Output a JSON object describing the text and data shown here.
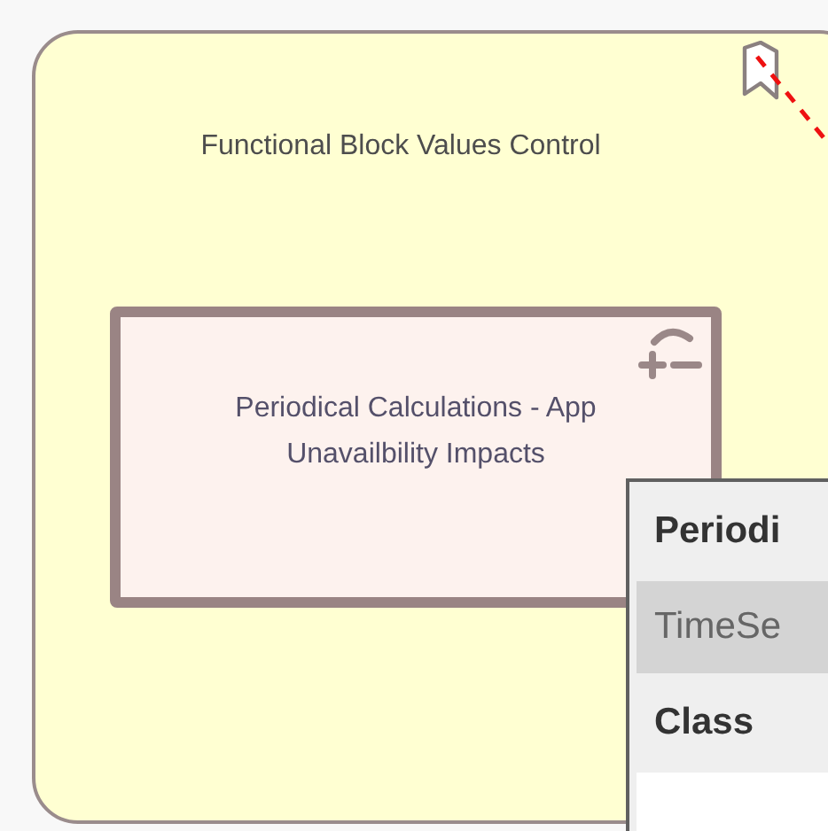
{
  "block": {
    "title": "Functional Block Values Control"
  },
  "inner_block": {
    "title": "Periodical Calculations - App Unavailbility Impacts"
  },
  "popup": {
    "rows": [
      {
        "kind": "header",
        "text": "Periodi"
      },
      {
        "kind": "item",
        "text": "TimeSe",
        "selected": true
      },
      {
        "kind": "header",
        "text": "Class"
      }
    ]
  }
}
